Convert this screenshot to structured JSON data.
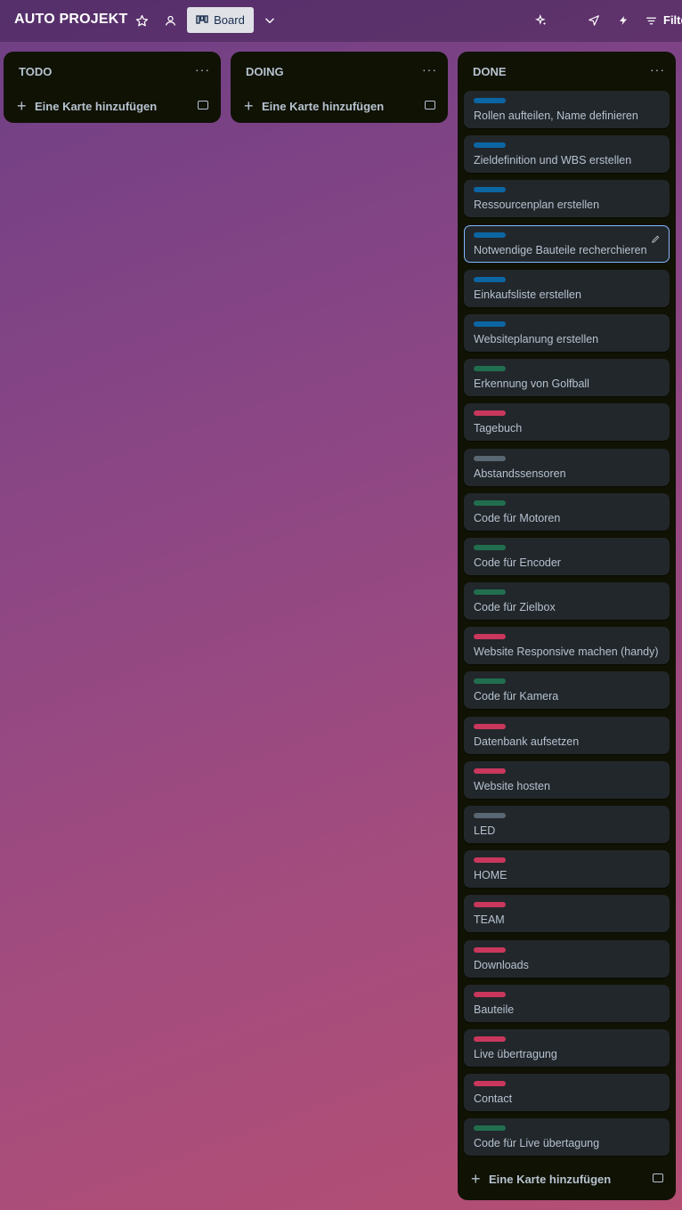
{
  "header": {
    "board_title": "AUTO PROJEKT",
    "view_label": "Board",
    "filter_label": "Filte"
  },
  "label_colors": {
    "blue": "#0c66a4",
    "green": "#216e4e",
    "red": "#c9375d",
    "gray": "#596773"
  },
  "lists": [
    {
      "title": "TODO",
      "add_card_label": "Eine Karte hinzufügen",
      "cards": []
    },
    {
      "title": "DOING",
      "add_card_label": "Eine Karte hinzufügen",
      "cards": []
    },
    {
      "title": "DONE",
      "add_card_label": "Eine Karte hinzufügen",
      "cards": [
        {
          "title": "Rollen aufteilen, Name definieren",
          "label": "blue"
        },
        {
          "title": "Zieldefinition und WBS erstellen",
          "label": "blue"
        },
        {
          "title": "Ressourcenplan erstellen",
          "label": "blue"
        },
        {
          "title": "Notwendige Bauteile recherchieren",
          "label": "blue",
          "selected": true
        },
        {
          "title": "Einkaufsliste erstellen",
          "label": "blue"
        },
        {
          "title": "Websiteplanung erstellen",
          "label": "blue"
        },
        {
          "title": "Erkennung von Golfball",
          "label": "green"
        },
        {
          "title": "Tagebuch",
          "label": "red"
        },
        {
          "title": "Abstandssensoren",
          "label": "gray"
        },
        {
          "title": "Code für Motoren",
          "label": "green"
        },
        {
          "title": "Code für Encoder",
          "label": "green"
        },
        {
          "title": "Code für Zielbox",
          "label": "green"
        },
        {
          "title": "Website Responsive machen (handy)",
          "label": "red"
        },
        {
          "title": "Code für Kamera",
          "label": "green"
        },
        {
          "title": "Datenbank aufsetzen",
          "label": "red"
        },
        {
          "title": "Website hosten",
          "label": "red"
        },
        {
          "title": "LED",
          "label": "gray"
        },
        {
          "title": "HOME",
          "label": "red"
        },
        {
          "title": "TEAM",
          "label": "red"
        },
        {
          "title": "Downloads",
          "label": "red"
        },
        {
          "title": "Bauteile",
          "label": "red"
        },
        {
          "title": "Live übertragung",
          "label": "red"
        },
        {
          "title": "Contact",
          "label": "red"
        },
        {
          "title": "Code für Live übertagung",
          "label": "green"
        }
      ]
    }
  ]
}
